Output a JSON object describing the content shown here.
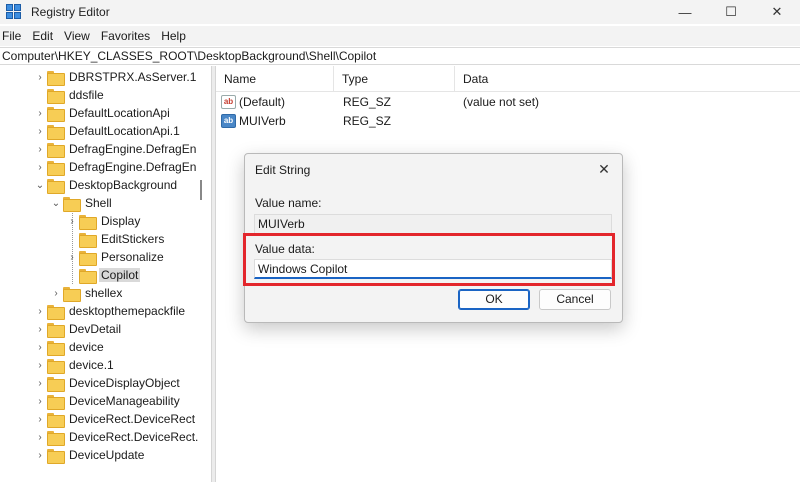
{
  "window": {
    "title": "Registry Editor",
    "minimize": "—",
    "maximize": "☐",
    "close": "✕"
  },
  "menu": [
    "File",
    "Edit",
    "View",
    "Favorites",
    "Help"
  ],
  "address": "Computer\\HKEY_CLASSES_ROOT\\DesktopBackground\\Shell\\Copilot",
  "tree": [
    {
      "label": "DBRSTPRX.AsServer.1",
      "chevron": "›"
    },
    {
      "label": "ddsfile",
      "chevron": ""
    },
    {
      "label": "DefaultLocationApi",
      "chevron": "›"
    },
    {
      "label": "DefaultLocationApi.1",
      "chevron": "›"
    },
    {
      "label": "DefragEngine.DefragEn",
      "chevron": "›"
    },
    {
      "label": "DefragEngine.DefragEn",
      "chevron": "›"
    },
    {
      "label": "DesktopBackground",
      "chevron": "⌄"
    },
    {
      "label": "Shell",
      "chevron": "⌄"
    },
    {
      "label": "Display",
      "chevron": "›"
    },
    {
      "label": "EditStickers",
      "chevron": ""
    },
    {
      "label": "Personalize",
      "chevron": "›"
    },
    {
      "label": "Copilot",
      "chevron": ""
    },
    {
      "label": "shellex",
      "chevron": "›"
    },
    {
      "label": "desktopthemepackfile",
      "chevron": "›"
    },
    {
      "label": "DevDetail",
      "chevron": "›"
    },
    {
      "label": "device",
      "chevron": "›"
    },
    {
      "label": "device.1",
      "chevron": "›"
    },
    {
      "label": "DeviceDisplayObject",
      "chevron": "›"
    },
    {
      "label": "DeviceManageability",
      "chevron": "›"
    },
    {
      "label": "DeviceRect.DeviceRect",
      "chevron": "›"
    },
    {
      "label": "DeviceRect.DeviceRect.",
      "chevron": "›"
    },
    {
      "label": "DeviceUpdate",
      "chevron": "›"
    }
  ],
  "list": {
    "headers": {
      "name": "Name",
      "type": "Type",
      "data": "Data"
    },
    "rows": [
      {
        "icon": "ab",
        "name": "(Default)",
        "type": "REG_SZ",
        "data": "(value not set)"
      },
      {
        "icon": "ab",
        "name": "MUIVerb",
        "type": "REG_SZ",
        "data": ""
      }
    ]
  },
  "dialog": {
    "title": "Edit String",
    "close": "✕",
    "value_name_label": "Value name:",
    "value_name": "MUIVerb",
    "value_data_label": "Value data:",
    "value_data": "Windows Copilot",
    "ok": "OK",
    "cancel": "Cancel"
  },
  "colors": {
    "highlight": "#e3262c",
    "accent": "#1a64c4"
  }
}
